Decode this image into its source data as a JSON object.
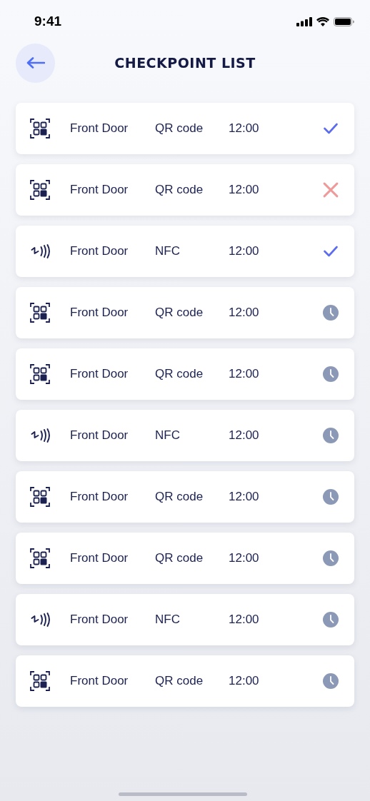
{
  "status_bar": {
    "time": "9:41"
  },
  "header": {
    "title": "CHECKPOINT LIST"
  },
  "checkpoints": [
    {
      "kind": "qr",
      "name": "Front Door",
      "method": "QR code",
      "time": "12:00",
      "done": true,
      "failed": false
    },
    {
      "kind": "qr",
      "name": "Front Door",
      "method": "QR code",
      "time": "12:00",
      "done": false,
      "failed": true
    },
    {
      "kind": "nfc",
      "name": "Front Door",
      "method": "NFC",
      "time": "12:00",
      "done": true,
      "failed": false
    },
    {
      "kind": "qr",
      "name": "Front Door",
      "method": "QR code",
      "time": "12:00",
      "done": false,
      "failed": false
    },
    {
      "kind": "qr",
      "name": "Front Door",
      "method": "QR code",
      "time": "12:00",
      "done": false,
      "failed": false
    },
    {
      "kind": "nfc",
      "name": "Front Door",
      "method": "NFC",
      "time": "12:00",
      "done": false,
      "failed": false
    },
    {
      "kind": "qr",
      "name": "Front Door",
      "method": "QR code",
      "time": "12:00",
      "done": false,
      "failed": false
    },
    {
      "kind": "qr",
      "name": "Front Door",
      "method": "QR code",
      "time": "12:00",
      "done": false,
      "failed": false
    },
    {
      "kind": "nfc",
      "name": "Front Door",
      "method": "NFC",
      "time": "12:00",
      "done": false,
      "failed": false
    },
    {
      "kind": "qr",
      "name": "Front Door",
      "method": "QR code",
      "time": "12:00",
      "done": false,
      "failed": false
    }
  ]
}
